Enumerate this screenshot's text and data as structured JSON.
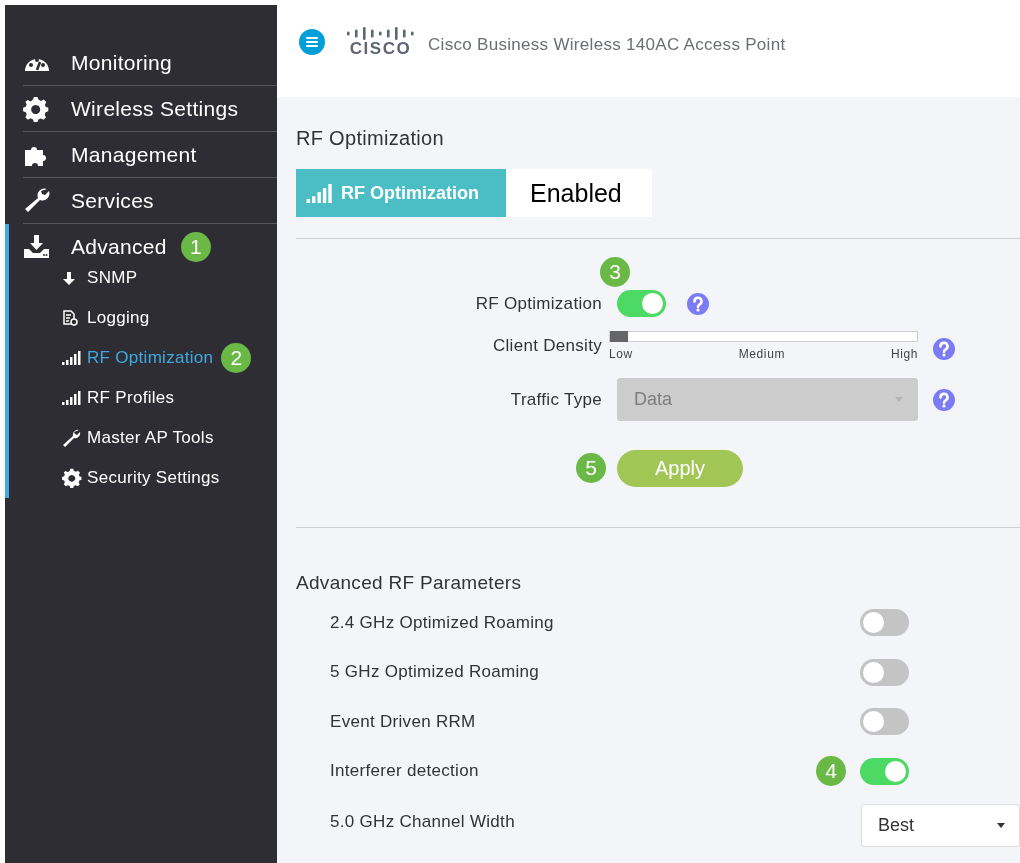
{
  "sidebar": {
    "items": [
      {
        "label": "Monitoring",
        "selected": false,
        "expanded": false
      },
      {
        "label": "Wireless Settings",
        "selected": false,
        "expanded": false
      },
      {
        "label": "Management",
        "selected": false,
        "expanded": false
      },
      {
        "label": "Services",
        "selected": false,
        "expanded": false
      },
      {
        "label": "Advanced",
        "selected": false,
        "expanded": true,
        "callout": "1",
        "children": [
          {
            "label": "SNMP",
            "selected": false
          },
          {
            "label": "Logging",
            "selected": false
          },
          {
            "label": "RF Optimization",
            "selected": true,
            "callout": "2"
          },
          {
            "label": "RF Profiles",
            "selected": false
          },
          {
            "label": "Master AP Tools",
            "selected": false
          },
          {
            "label": "Security Settings",
            "selected": false
          }
        ]
      }
    ]
  },
  "header": {
    "logo_text": "CISCO",
    "title": "Cisco Business Wireless 140AC Access Point"
  },
  "page_title": "RF Optimization",
  "status": {
    "label": "RF Optimization",
    "value": "Enabled"
  },
  "settings": [
    {
      "kind": "toggle",
      "label": "RF Optimization",
      "on": true,
      "callout": "3"
    },
    {
      "kind": "slider",
      "label": "Client Density",
      "level": 0,
      "ticks": [
        "Low",
        "Medium",
        "High"
      ]
    },
    {
      "kind": "select",
      "label": "Traffic Type",
      "value": "Data",
      "disabled": true
    }
  ],
  "apply": {
    "label": "Apply",
    "callout": "5"
  },
  "advanced": {
    "title": "Advanced RF Parameters",
    "rows": [
      {
        "kind": "toggle",
        "label": "2.4 GHz Optimized Roaming",
        "on": false
      },
      {
        "kind": "toggle",
        "label": "5 GHz Optimized Roaming",
        "on": false
      },
      {
        "kind": "toggle",
        "label": "Event Driven RRM",
        "on": false
      },
      {
        "kind": "toggle",
        "label": "Interferer detection",
        "on": true,
        "callout": "4"
      },
      {
        "kind": "select",
        "label": "5.0 GHz Channel Width",
        "value": "Best",
        "disabled": false
      }
    ]
  }
}
